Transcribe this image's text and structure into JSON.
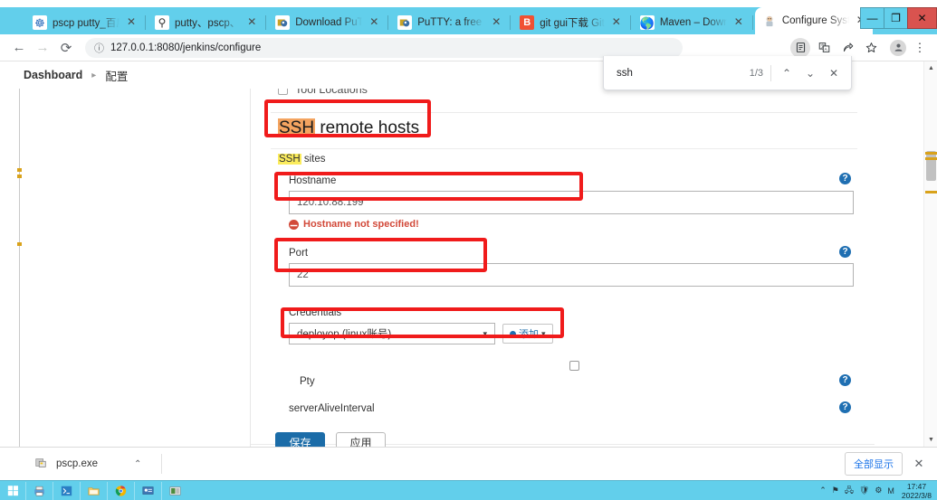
{
  "browser": {
    "tabs": [
      {
        "title": "pscp putty_百度",
        "icon": "puzzle-icon",
        "active": false
      },
      {
        "title": "putty、pscp、",
        "icon": "putty-icon",
        "active": false
      },
      {
        "title": "Download PuT",
        "icon": "putty-icon",
        "active": false
      },
      {
        "title": "PuTTY: a free S",
        "icon": "putty-icon",
        "active": false
      },
      {
        "title": "git gui下载 Git",
        "icon": "baidu-icon",
        "active": false
      },
      {
        "title": "Maven – Down",
        "icon": "globe-icon",
        "active": false
      },
      {
        "title": "Configure Syst",
        "icon": "jenkins-icon",
        "active": true
      }
    ],
    "new_tab_label": "+",
    "tab_list_label": "⌄",
    "window_controls": {
      "minimize": "—",
      "maximize": "❐",
      "close": "✕"
    },
    "toolbar": {
      "back": "←",
      "forward": "→",
      "reload": "⟳",
      "site_info_icon": "info-icon",
      "url": "127.0.0.1:8080/jenkins/configure",
      "icons": [
        "reader-mode-icon",
        "translate-icon",
        "share-icon",
        "bookmark-star-icon"
      ],
      "avatar": "👤",
      "menu": "⋮"
    }
  },
  "find_bar": {
    "query": "ssh",
    "match_count": "1/3",
    "prev_label": "⌃",
    "next_label": "⌄",
    "close_label": "✕"
  },
  "jenkins": {
    "breadcrumb": {
      "dashboard": "Dashboard",
      "separator": "▸",
      "current": "配置"
    },
    "prev_section_label": "Tool Locations",
    "section": {
      "title_highlight": "SSH",
      "title_rest": " remote hosts",
      "subtitle_highlight": "SSH",
      "subtitle_rest": " sites"
    },
    "fields": {
      "hostname_label": "Hostname",
      "hostname_value": "120.10.88.199",
      "hostname_error": "Hostname not specified!",
      "port_label": "Port",
      "port_value": "22",
      "credentials_label": "Credentials",
      "credentials_value": "deployop (linux账号)",
      "credentials_add_button": "添加",
      "pty_label": "Pty",
      "server_alive_label": "serverAliveInterval",
      "help_icon": "?"
    },
    "buttons": {
      "save": "保存",
      "apply": "应用"
    }
  },
  "download_shelf": {
    "file_name": "pscp.exe",
    "file_icon": "exe-file-icon",
    "expand_label": "⌃",
    "show_all_label": "全部显示",
    "close_label": "✕"
  },
  "taskbar": {
    "start_label": "⊞",
    "apps": [
      "printer-icon",
      "terminal-icon",
      "explorer-icon",
      "chrome-icon",
      "remote-desktop-icon",
      "media-icon"
    ],
    "tray_icons": [
      "⌃",
      "⚑",
      "🖧",
      "🛡",
      "⚙",
      "M"
    ],
    "time": "17:47",
    "date": "2022/3/8"
  },
  "colors": {
    "window_accent": "#62cfeb",
    "annotation": "#f01b1b",
    "jenkins_blue": "#1b6ca8",
    "error_red": "#d24939",
    "active_find_highlight": "#f4a460",
    "find_highlight": "#fbec5d"
  }
}
